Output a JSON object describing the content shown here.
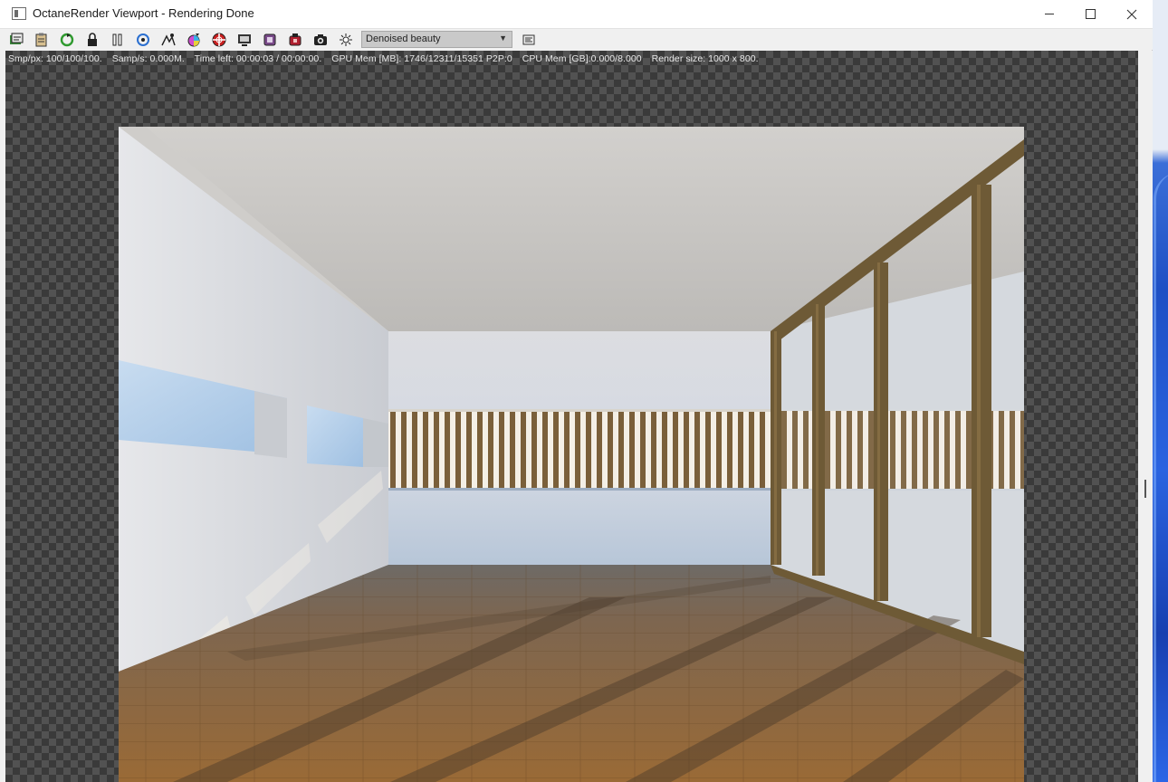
{
  "window": {
    "title": "OctaneRender Viewport - Rendering Done",
    "controls": [
      "minimize",
      "maximize",
      "close"
    ]
  },
  "toolbar": {
    "icons": [
      "send-scene-icon",
      "copy-clipboard-icon",
      "restart-render-icon",
      "lock-icon",
      "pause-icon",
      "refresh-icon",
      "focus-picker-icon",
      "color-picker-icon",
      "region-render-icon",
      "film-region-icon",
      "material-picker-icon",
      "object-picker-icon",
      "camera-icon",
      "light-icon"
    ],
    "render_pass": "Denoised beauty",
    "extra_button": "settings-icon"
  },
  "status": {
    "samples": "Smp/px: 100/100/100.",
    "samples_per_sec": "Samp/s: 0.000M.",
    "time_left": "Time left: 00:00:03 / 00:00:00.",
    "gpu_mem": "GPU Mem [MB]: 1746/12311/15351 P2P:0",
    "cpu_mem": "CPU Mem [GB]:0.000/8.000",
    "render_size": "Render size: 1000 x 800."
  },
  "render": {
    "description": "interior-render",
    "colors": {
      "ceiling": "#c9c8c5",
      "wall": "#dfe2e6",
      "floor": "#8a6235",
      "frame": "#6e5a36",
      "sky": "#bcd3ea"
    }
  }
}
